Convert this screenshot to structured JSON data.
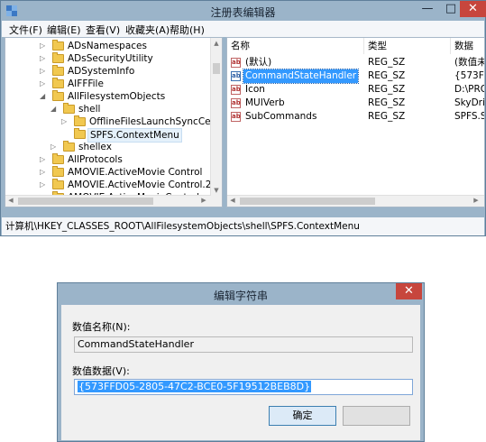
{
  "regedit": {
    "title": "注册表编辑器",
    "window_buttons": {
      "minimize": "—",
      "maximize": "□",
      "close": "✕"
    },
    "menu": [
      "文件(F)",
      "编辑(E)",
      "查看(V)",
      "收藏夹(A)",
      "帮助(H)"
    ],
    "tree": [
      {
        "label": "ADsNamespaces",
        "level": 0,
        "expander": "collapsed",
        "selected": false
      },
      {
        "label": "ADsSecurityUtility",
        "level": 0,
        "expander": "collapsed",
        "selected": false
      },
      {
        "label": "ADSystemInfo",
        "level": 0,
        "expander": "collapsed",
        "selected": false
      },
      {
        "label": "AIFFFile",
        "level": 0,
        "expander": "collapsed",
        "selected": false
      },
      {
        "label": "AllFilesystemObjects",
        "level": 0,
        "expander": "expanded",
        "selected": false
      },
      {
        "label": "shell",
        "level": 1,
        "expander": "expanded",
        "selected": false
      },
      {
        "label": "OfflineFilesLaunchSyncCenter",
        "level": 2,
        "expander": "collapsed",
        "selected": false
      },
      {
        "label": "SPFS.ContextMenu",
        "level": 2,
        "expander": "none",
        "selected": true
      },
      {
        "label": "shellex",
        "level": 1,
        "expander": "collapsed",
        "selected": false
      },
      {
        "label": "AllProtocols",
        "level": 0,
        "expander": "collapsed",
        "selected": false
      },
      {
        "label": "AMOVIE.ActiveMovie Control",
        "level": 0,
        "expander": "collapsed",
        "selected": false
      },
      {
        "label": "AMOVIE.ActiveMovie Control.2",
        "level": 0,
        "expander": "collapsed",
        "selected": false
      },
      {
        "label": "AMOVIE.ActiveMovieControl",
        "level": 0,
        "expander": "collapsed",
        "selected": false
      }
    ],
    "list_columns": [
      "名称",
      "类型",
      "数据"
    ],
    "values": [
      {
        "name": "(默认)",
        "type": "REG_SZ",
        "data": "(数值未",
        "selected": false
      },
      {
        "name": "CommandStateHandler",
        "type": "REG_SZ",
        "data": "{573FF",
        "selected": true
      },
      {
        "name": "Icon",
        "type": "REG_SZ",
        "data": "D:\\PRO",
        "selected": false
      },
      {
        "name": "MUIVerb",
        "type": "REG_SZ",
        "data": "SkyDri",
        "selected": false
      },
      {
        "name": "SubCommands",
        "type": "REG_SZ",
        "data": "SPFS.S",
        "selected": false
      }
    ],
    "status_path": "计算机\\HKEY_CLASSES_ROOT\\AllFilesystemObjects\\shell\\SPFS.ContextMenu"
  },
  "dialog": {
    "title": "编辑字符串",
    "close": "✕",
    "name_label": "数值名称(N):",
    "name_value": "CommandStateHandler",
    "data_label": "数值数据(V):",
    "data_value": "{573FFD05-2805-47C2-BCE0-5F19512BEB8D}",
    "ok_label": "确定",
    "cancel_label": ""
  },
  "icons": {
    "app_icon": "regedit-icon",
    "folder_icon": "folder-icon",
    "string_value_icon": "string-value-icon"
  },
  "colors": {
    "frame": "#9bb4c9",
    "selection": "#3399ff",
    "close_button": "#c7463d",
    "folder": "#f1c850"
  }
}
